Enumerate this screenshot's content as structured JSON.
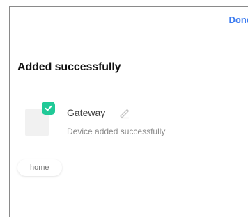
{
  "header": {
    "done_label": "Done"
  },
  "main": {
    "title": "Added successfully",
    "device": {
      "name": "Gateway",
      "status": "Device added successfully",
      "icon": "edit-pencil-icon",
      "badge": "check-icon"
    },
    "rooms": [
      {
        "label": "home"
      }
    ]
  },
  "colors": {
    "accent": "#3d7cf0",
    "success": "#20c997"
  }
}
